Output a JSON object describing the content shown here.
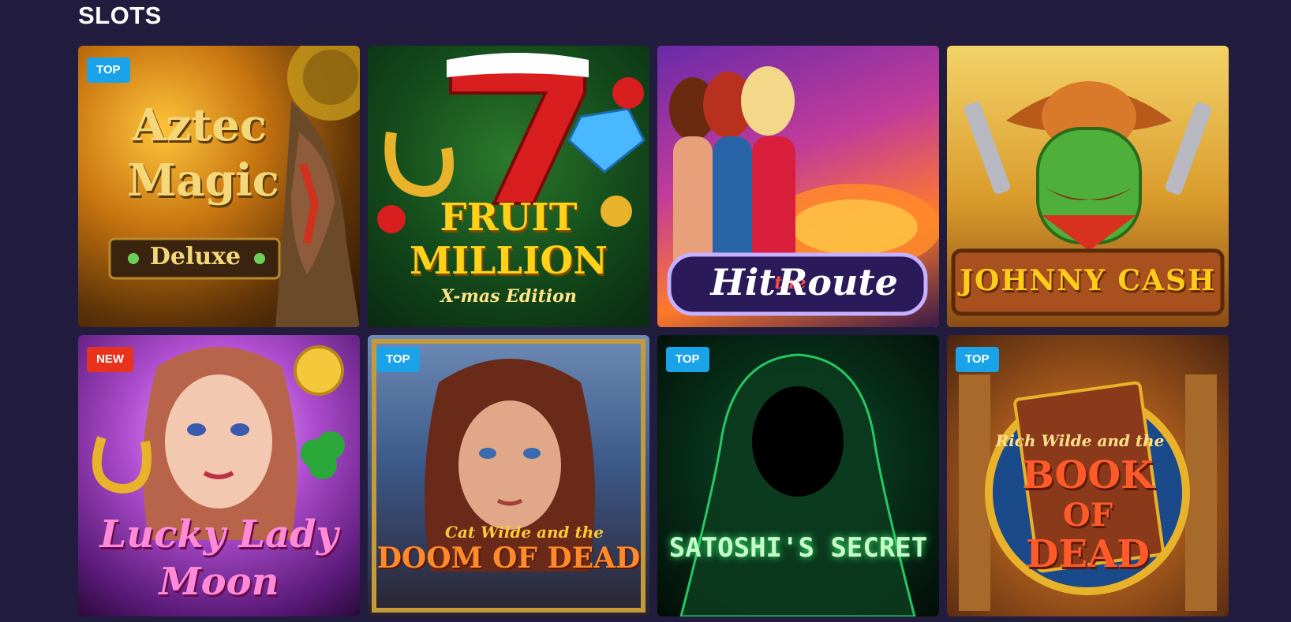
{
  "section": {
    "title": "SLOTS"
  },
  "colors": {
    "background": "#221c3e",
    "badge_top": "#1aa3e8",
    "badge_new": "#e8321e"
  },
  "games": [
    {
      "title_line1": "Aztec",
      "title_line2": "Magic",
      "subtitle": "Deluxe",
      "badge": "TOP"
    },
    {
      "title_line1": "FRUIT",
      "title_line2": "MILLION",
      "subtitle": "X-mas Edition",
      "badge": ""
    },
    {
      "title_line1": "Hit",
      "title_line2": "the",
      "subtitle": "Route",
      "badge": ""
    },
    {
      "title_line1": "JOHNNY CASH",
      "badge": ""
    },
    {
      "title_line1": "Lucky Lady",
      "title_line2": "Moon",
      "badge": "NEW"
    },
    {
      "title_line1": "Cat Wilde and the",
      "title_line2": "DOOM OF DEAD",
      "badge": "TOP"
    },
    {
      "title_line1": "SATOSHI'S SECRET",
      "badge": "TOP"
    },
    {
      "title_line1": "Rich Wilde and the",
      "title_line2": "BOOK",
      "title_line3": "OF",
      "title_line4": "DEAD",
      "badge": "TOP"
    }
  ]
}
